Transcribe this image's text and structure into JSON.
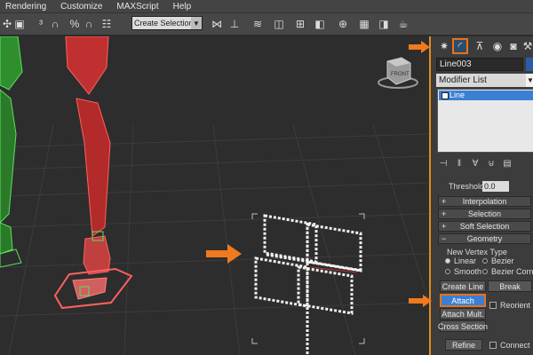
{
  "menubar": {
    "items": [
      "Rendering",
      "Customize",
      "MAXScript",
      "Help"
    ]
  },
  "toolbar": {
    "selection_set_value": "Create Selection Se"
  },
  "viewport": {
    "viewcube_label": "FRONT"
  },
  "panel": {
    "object_name": "Line003",
    "modifier_list_label": "Modifier List",
    "stack_item": "Line",
    "threshold_label": "Threshold:",
    "threshold_value": "0.0",
    "rollouts": {
      "interpolation": "Interpolation",
      "selection": "Selection",
      "soft_selection": "Soft Selection",
      "geometry": "Geometry"
    },
    "geometry": {
      "new_vertex_type_label": "New Vertex Type",
      "linear": "Linear",
      "bezier": "Bezier",
      "smooth": "Smooth",
      "bezier_corner": "Bezier Corner",
      "create_line": "Create Line",
      "break": "Break",
      "attach": "Attach",
      "reorient": "Reorient",
      "attach_mult": "Attach Mult.",
      "cross_section": "Cross Section",
      "refine": "Refine",
      "connect": "Connect"
    }
  },
  "colors": {
    "accent": "#e8721d",
    "selection": "#3b7fd4",
    "object_color": "#2a5da8"
  }
}
